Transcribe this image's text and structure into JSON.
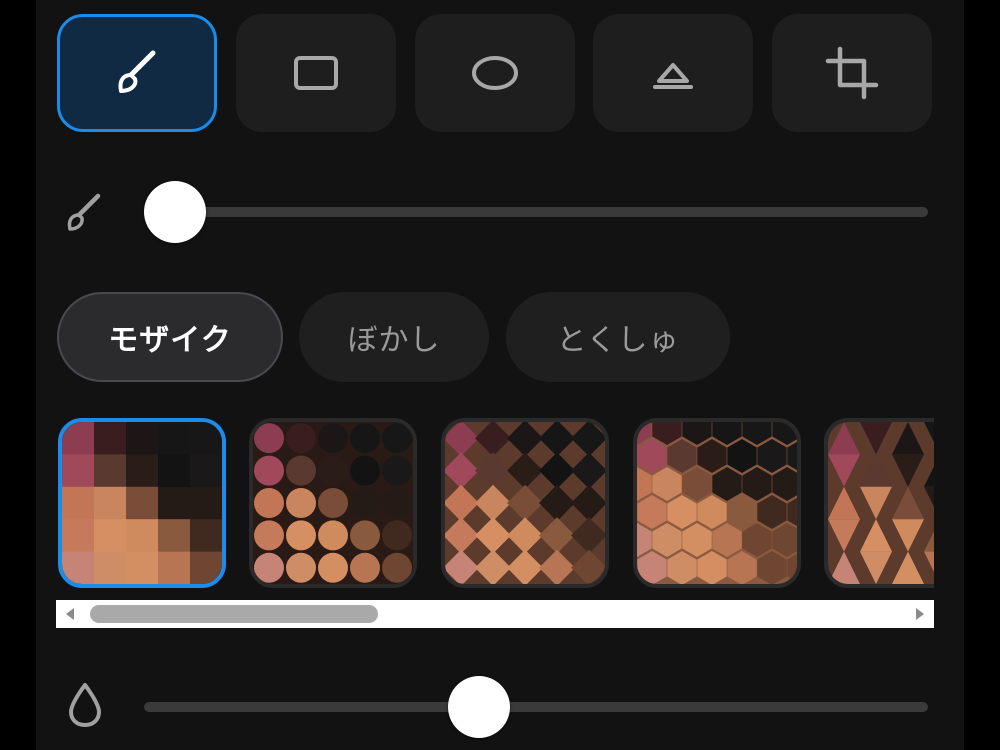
{
  "tools": [
    {
      "name": "brush",
      "selected": true
    },
    {
      "name": "rectangle",
      "selected": false
    },
    {
      "name": "ellipse",
      "selected": false
    },
    {
      "name": "eraser",
      "selected": false
    },
    {
      "name": "crop",
      "selected": false
    }
  ],
  "brush_size_slider": {
    "icon": "brush-icon",
    "value_fraction": 0.02
  },
  "effects": {
    "items": [
      {
        "label": "モザイク",
        "selected": true
      },
      {
        "label": "ぼかし",
        "selected": false
      },
      {
        "label": "とくしゅ",
        "selected": false
      }
    ]
  },
  "patterns": [
    {
      "name": "square-mosaic",
      "selected": true
    },
    {
      "name": "circle-mosaic",
      "selected": false
    },
    {
      "name": "diamond-mosaic",
      "selected": false
    },
    {
      "name": "hexagon-mosaic",
      "selected": false
    },
    {
      "name": "triangle-mosaic",
      "selected": false
    }
  ],
  "opacity_slider": {
    "icon": "droplet-icon",
    "value_fraction": 0.43
  },
  "colors": {
    "accent": "#1b8cea",
    "selected_tool_bg": "#102a44",
    "panel_bg": "#121212",
    "button_bg": "#1e1e1e"
  }
}
